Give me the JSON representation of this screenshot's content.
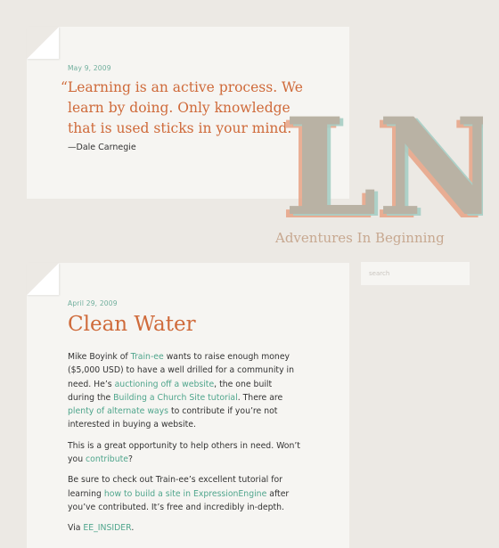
{
  "quote_post": {
    "date": "May 9, 2009",
    "quote_line1": "“Learning is an active process. We",
    "quote_line2": "learn by doing. Only knowledge",
    "quote_line3": "that is used sticks in your mind.”",
    "author": "—Dale Carnegie"
  },
  "brand": {
    "logo_letters": "LN",
    "tagline": "Adventures In Beginning",
    "colors": {
      "logo_fill": "#b9b2a4",
      "logo_shadow_teal": "#a7cfc5",
      "logo_shadow_orange": "#e8a385",
      "accent_orange": "#cf6a3a",
      "accent_green": "#4fa58c"
    }
  },
  "search": {
    "placeholder": "search"
  },
  "post": {
    "date": "April 29, 2009",
    "title": "Clean Water",
    "p1": {
      "t1": "Mike Boyink of ",
      "l1": "Train-ee",
      "t2": " wants to raise enough money ($5,000 USD) to have a well drilled for a community in need. He’s ",
      "l2": "auctioning off a website",
      "t3": ", the one built during the ",
      "l3": "Building a Church Site tutorial",
      "t4": ". There are ",
      "l4": "plenty of alternate ways",
      "t5": " to contribute if you’re not interested in buying a website."
    },
    "p2": {
      "t1": "This is a great opportunity to help others in need. Won’t you ",
      "l1": "contribute",
      "t2": "?"
    },
    "p3": {
      "t1": "Be sure to check out Train-ee’s excellent tutorial for learning ",
      "l1": "how to build a site in ExpressionEngine",
      "t2": " after you’ve contributed. It’s free and incredibly in-depth."
    },
    "p4": {
      "t1": "Via ",
      "l1": "EE_INSIDER",
      "t2": "."
    }
  }
}
